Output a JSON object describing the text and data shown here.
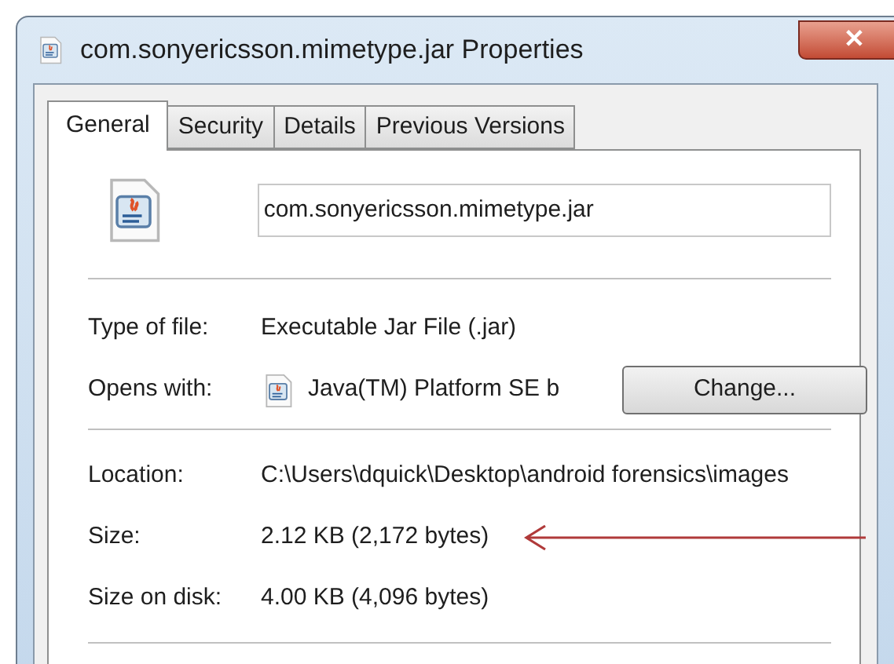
{
  "window": {
    "title": "com.sonyericsson.mimetype.jar Properties",
    "close": "✕"
  },
  "tabs": [
    {
      "label": "General",
      "selected": true
    },
    {
      "label": "Security",
      "selected": false
    },
    {
      "label": "Details",
      "selected": false
    },
    {
      "label": "Previous Versions",
      "selected": false
    }
  ],
  "file_name": {
    "value": "com.sonyericsson.mimetype.jar"
  },
  "type_section": [
    {
      "label": "Type of file:",
      "value": "Executable Jar File (.jar)"
    },
    {
      "label": "Opens with:",
      "value": "Java(TM) Platform SE b",
      "button": "Change..."
    }
  ],
  "location_section": [
    {
      "label": "Location:",
      "value": "C:\\Users\\dquick\\Desktop\\android forensics\\images"
    },
    {
      "label": "Size:",
      "value": "2.12 KB (2,172 bytes)"
    },
    {
      "label": "Size on disk:",
      "value": "4.00 KB (4,096 bytes)"
    }
  ]
}
